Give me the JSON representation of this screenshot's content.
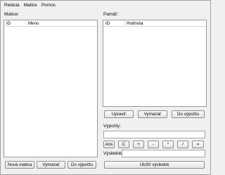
{
  "menubar": {
    "items": [
      "Relácia",
      "Matice",
      "Pomoc"
    ]
  },
  "left_panel": {
    "label": "Matice:",
    "columns": [
      "ID",
      "Meno"
    ],
    "buttons": [
      "Nová matica",
      "Vymazať",
      "Do výpočtu"
    ]
  },
  "right_panel": {
    "label": "Pamäť:",
    "columns": [
      "ID",
      "Hodnota"
    ],
    "buttons": [
      "Upraviť",
      "Vymazať",
      "Do výpočtu"
    ],
    "calc_label": "Výpočty:",
    "calc_value": "",
    "operator_buttons": [
      "Ans",
      "C",
      "+",
      "-",
      "*",
      "/",
      "="
    ],
    "result_label": "Výsledok:",
    "result_value": "",
    "save_result_label": "Uložiť výsledok"
  }
}
